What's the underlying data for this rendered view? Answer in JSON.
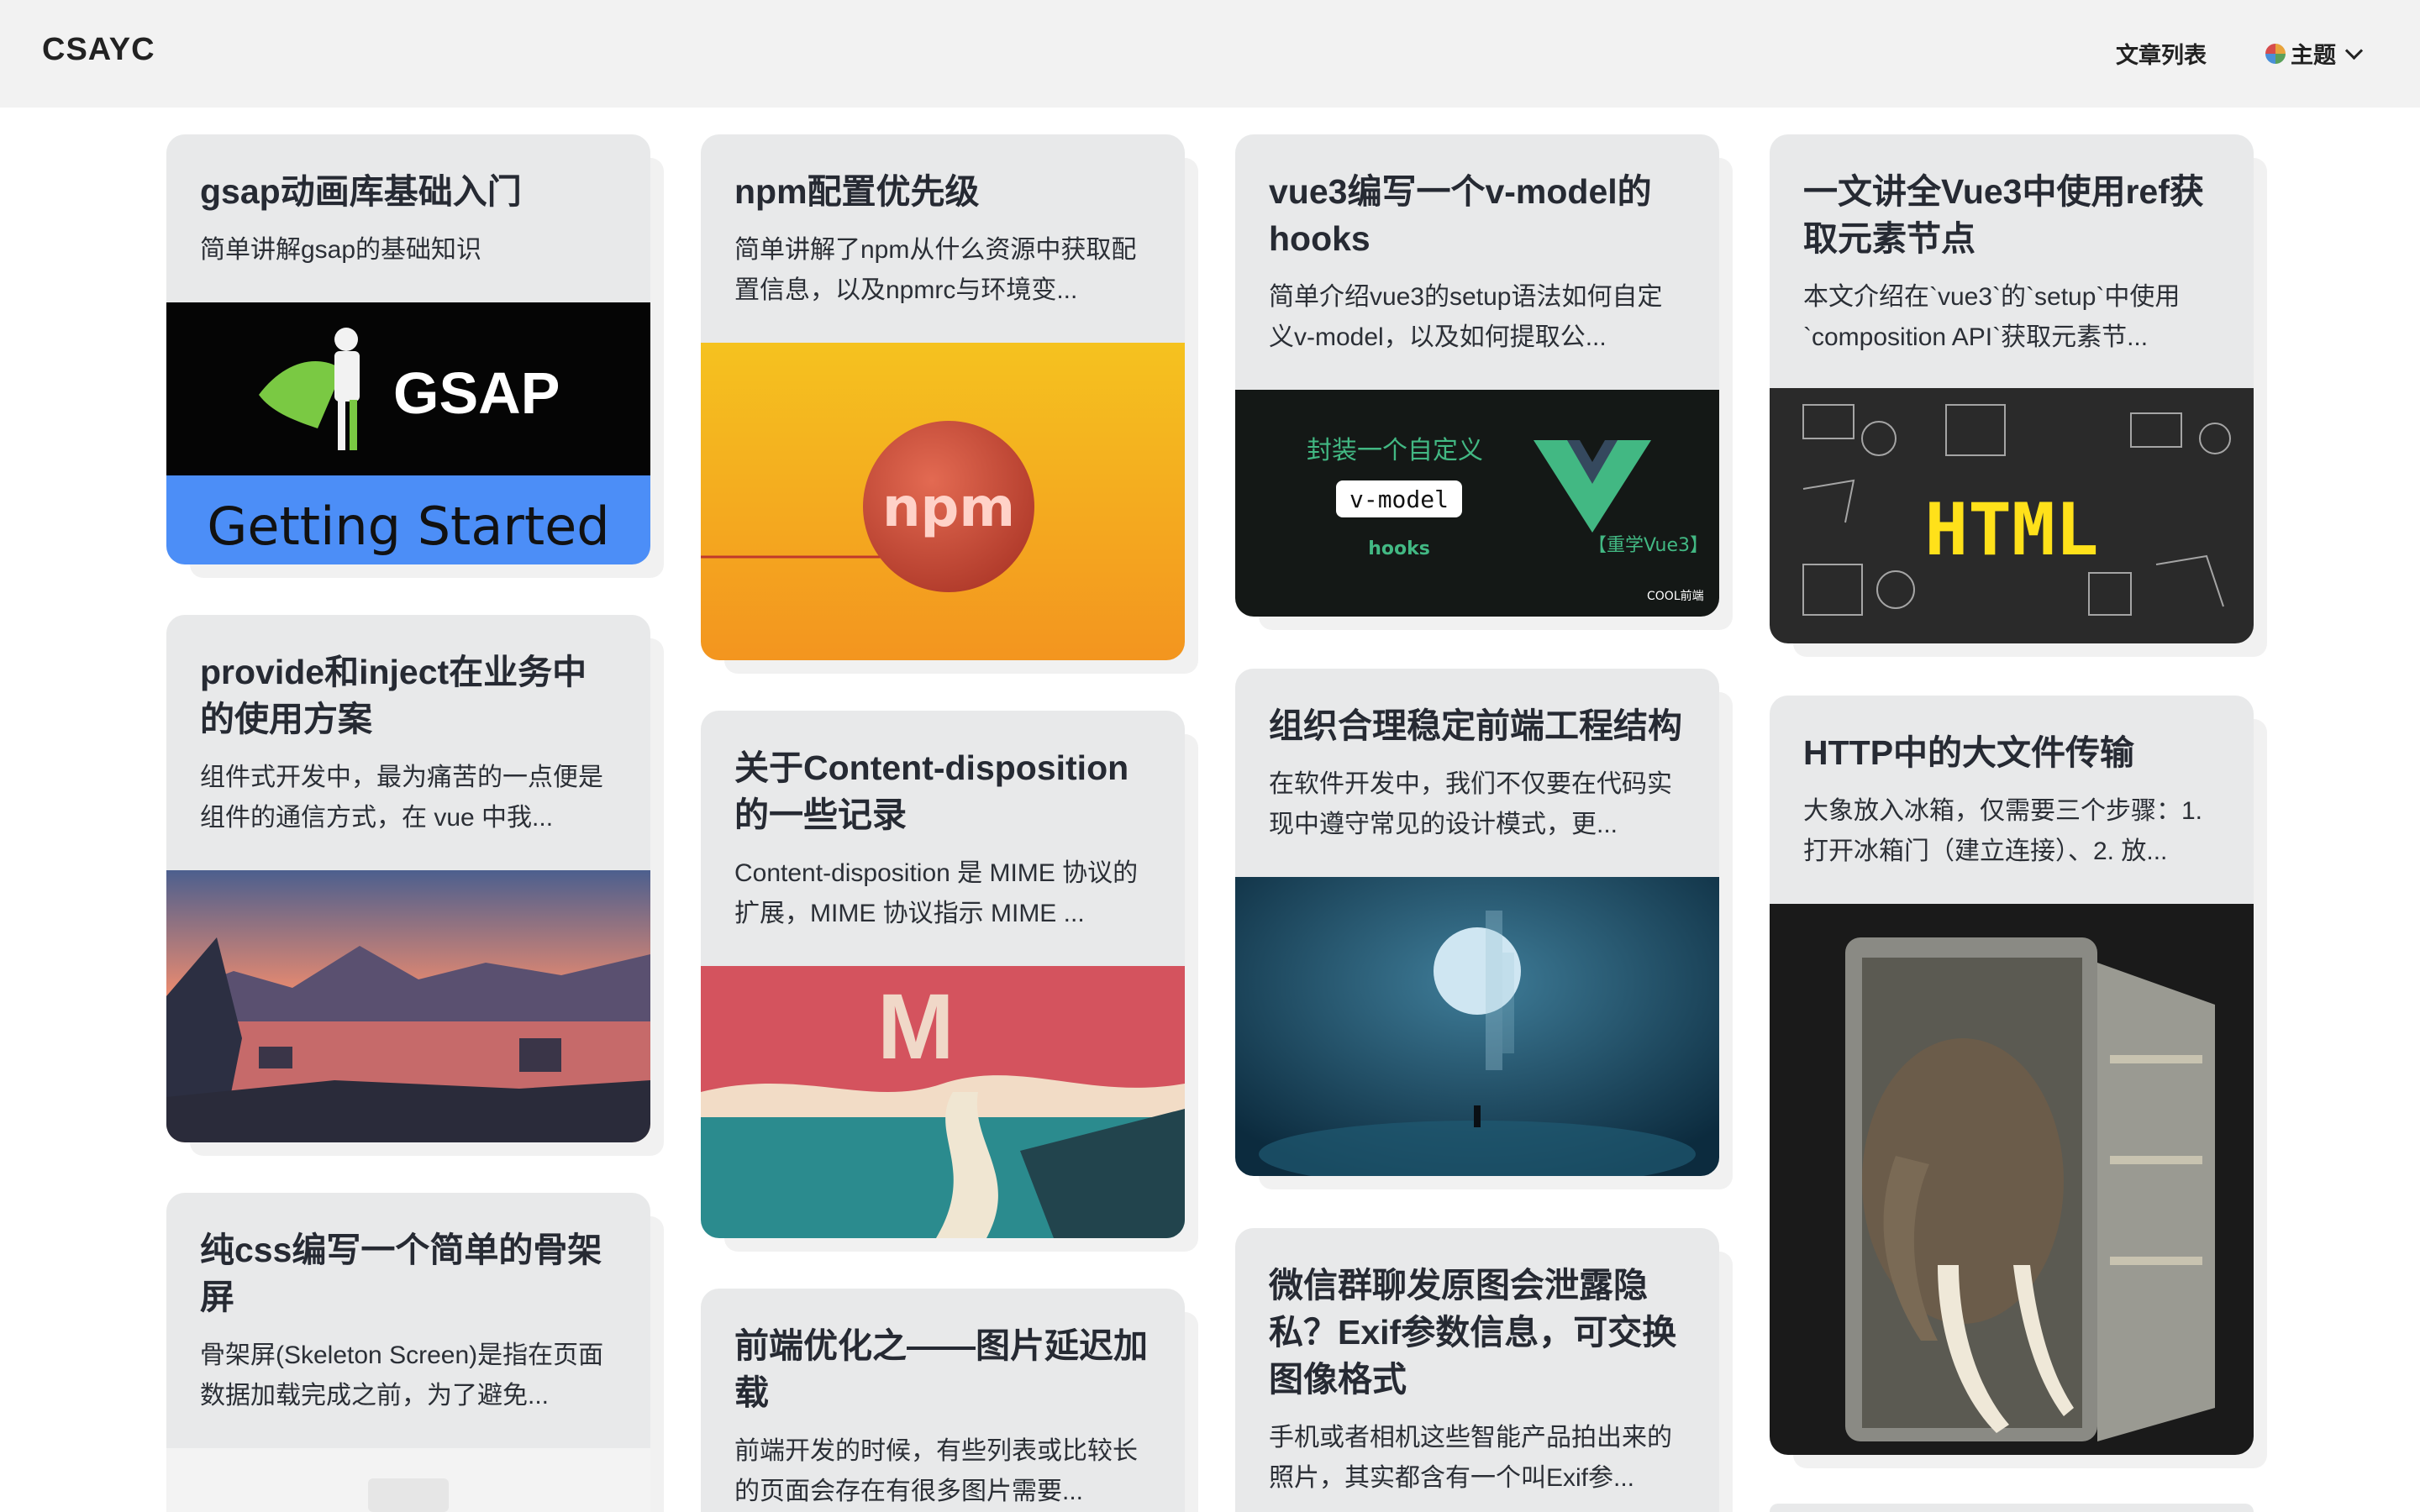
{
  "header": {
    "brand": "CSAYC",
    "nav_articles": "文章列表",
    "theme_label": "主题"
  },
  "cards": [
    {
      "title": "gsap动画库基础入门",
      "desc": "简单讲解gsap的基础知识",
      "image_text": [
        "GSAP",
        "Getting Started"
      ]
    },
    {
      "title": "npm配置优先级",
      "desc": "简单讲解了npm从什么资源中获取配置信息，以及npmrc与环境变...",
      "image_text": [
        "npm"
      ]
    },
    {
      "title": "vue3编写一个v-model的hooks",
      "desc": "简单介绍vue3的setup语法如何自定义v-model，以及如何提取公...",
      "image_text": [
        "封装一个自定义",
        "v-model",
        "hooks",
        "【重学Vue3】",
        "COOL前端"
      ]
    },
    {
      "title": "一文讲全Vue3中使用ref获取元素节点",
      "desc": "本文介绍在`vue3`的`setup`中使用`composition API`获取元素节...",
      "image_text": [
        "HTML"
      ]
    },
    {
      "title": "provide和inject在业务中的使用方案",
      "desc": "组件式开发中，最为痛苦的一点便是组件的通信方式，在 vue 中我..."
    },
    {
      "title": "关于Content-disposition的一些记录",
      "desc": "Content-disposition 是 MIME 协议的扩展，MIME 协议指示 MIME ..."
    },
    {
      "title": "组织合理稳定前端工程结构",
      "desc": "在软件开发中，我们不仅要在代码实现中遵守常见的设计模式，更..."
    },
    {
      "title": "HTTP中的大文件传输",
      "desc": "大象放入冰箱，仅需要三个步骤：1. 打开冰箱门（建立连接）、2. 放..."
    },
    {
      "title": "纯css编写一个简单的骨架屏",
      "desc": "骨架屏(Skeleton Screen)是指在页面数据加载完成之前，为了避免..."
    },
    {
      "title": "前端优化之——图片延迟加载",
      "desc": "前端开发的时候，有些列表或比较长的页面会存在有很多图片需要..."
    },
    {
      "title": "微信群聊发原图会泄露隐私？Exif参数信息，可交换图像格式",
      "desc": "手机或者相机这些智能产品拍出来的照片，其实都含有一个叫Exif参..."
    }
  ],
  "colors": {
    "topbar_bg": "#f2f2f2",
    "card_bg": "#e8e9ea",
    "gsap_blue": "#4c8ef7",
    "npm_orange": "#f3a21d",
    "vue_green": "#42b883"
  }
}
